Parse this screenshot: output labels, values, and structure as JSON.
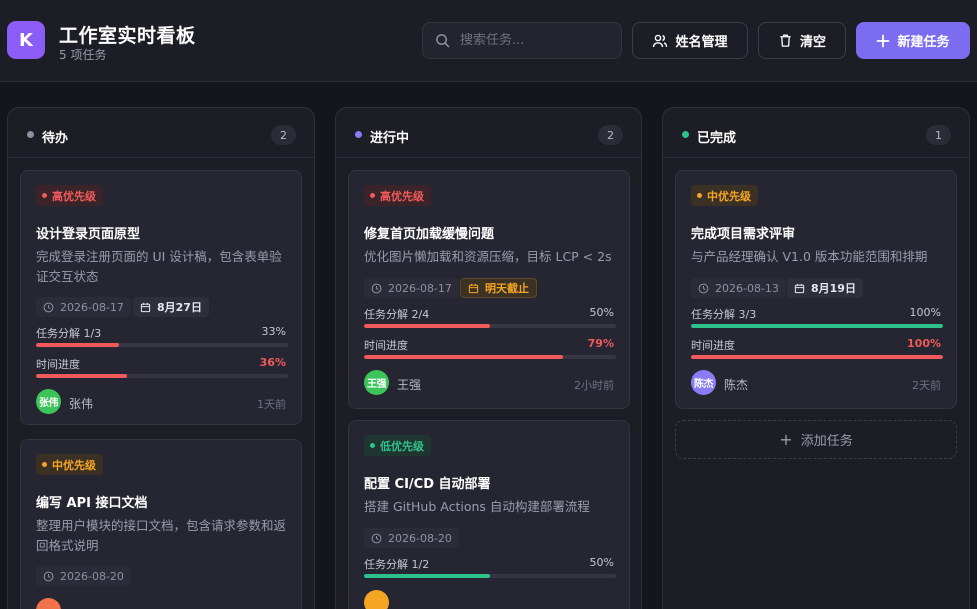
{
  "app": {
    "logo_letter": "K",
    "title": "工作室实时看板",
    "subtitle": "5 项任务"
  },
  "toolbar": {
    "search_placeholder": "搜索任务...",
    "name_manage_label": "姓名管理",
    "clear_label": "清空",
    "new_task_label": "新建任务"
  },
  "labels": {
    "subtasks_prefix": "任务分解",
    "time_progress": "时间进度",
    "add_task": "添加任务"
  },
  "colors": {
    "accent": "#7c6cf0",
    "todo_dot": "#8e90a0",
    "doing_dot": "#8b7cf6",
    "done_dot": "#2fc18c",
    "high": "#f05a5a",
    "mid": "#f5a524",
    "low": "#2fc18c"
  },
  "columns": [
    {
      "title": "待办",
      "count": "2",
      "cards": [
        {
          "priority": "高优先级",
          "title": "设计登录页面原型",
          "desc": "完成登录注册页面的 UI 设计稿，包含表单验证交互状态",
          "date": "2026-08-17",
          "due": "8月27日",
          "subtasks": "1/3",
          "subtasks_pct": "33%",
          "subtasks_value": 0.33,
          "time_pct": "36%",
          "time_value": 0.36,
          "assignee": "张伟",
          "avatar_text": "张伟",
          "updated": "1天前"
        },
        {
          "priority": "中优先级",
          "title": "编写 API 接口文档",
          "desc": "整理用户模块的接口文档，包含请求参数和返回格式说明",
          "date": "2026-08-20"
        }
      ]
    },
    {
      "title": "进行中",
      "count": "2",
      "cards": [
        {
          "priority": "高优先级",
          "title": "修复首页加载缓慢问题",
          "desc": "优化图片懒加载和资源压缩，目标 LCP < 2s",
          "date": "2026-08-17",
          "due": "明天截止",
          "subtasks": "2/4",
          "subtasks_pct": "50%",
          "subtasks_value": 0.5,
          "time_pct": "79%",
          "time_value": 0.79,
          "assignee": "王强",
          "avatar_text": "王强",
          "updated": "2小时前"
        },
        {
          "priority": "低优先级",
          "title": "配置 CI/CD 自动部署",
          "desc": "搭建 GitHub Actions 自动构建部署流程",
          "date": "2026-08-20",
          "subtasks": "1/2",
          "subtasks_pct": "50%",
          "subtasks_value": 0.5
        }
      ]
    },
    {
      "title": "已完成",
      "count": "1",
      "cards": [
        {
          "priority": "中优先级",
          "title": "完成项目需求评审",
          "desc": "与产品经理确认 V1.0 版本功能范围和排期",
          "date": "2026-08-13",
          "due": "8月19日",
          "subtasks": "3/3",
          "subtasks_pct": "100%",
          "subtasks_value": 1.0,
          "time_pct": "100%",
          "time_value": 1.0,
          "assignee": "陈杰",
          "avatar_text": "陈杰",
          "updated": "2天前"
        }
      ]
    }
  ]
}
